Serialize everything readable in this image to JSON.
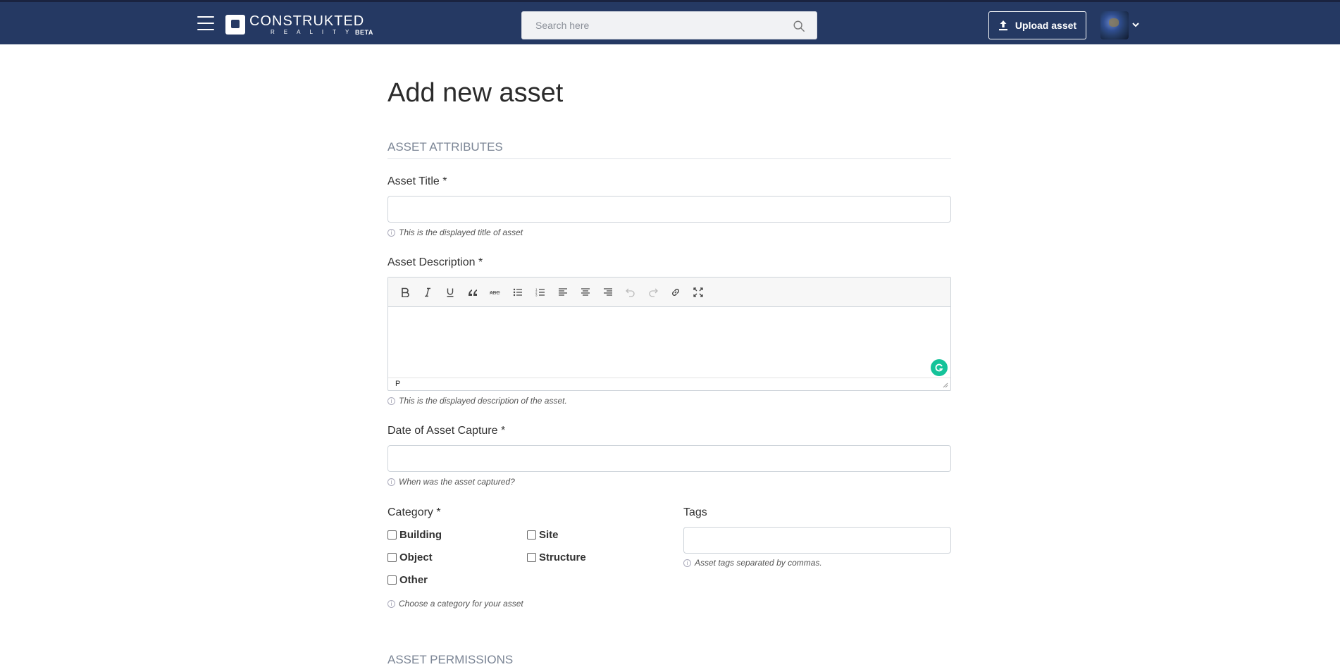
{
  "nav": {
    "logo_main": "CONSTRUKTED",
    "logo_sub": "REALITY",
    "logo_badge": "BETA",
    "search_placeholder": "Search here",
    "upload_label": "Upload asset",
    "brand_color": "#253963"
  },
  "page": {
    "title": "Add new asset",
    "section_attributes": "ASSET ATTRIBUTES",
    "section_permissions": "ASSET PERMISSIONS"
  },
  "form": {
    "title_label": "Asset Title *",
    "title_value": "",
    "title_help": "This is the displayed title of asset",
    "description_label": "Asset Description *",
    "description_help": "This is the displayed description of the asset.",
    "editor_status": "P",
    "editor_toolbar": [
      "bold-icon",
      "italic-icon",
      "underline-icon",
      "quote-icon",
      "strikethrough-icon",
      "bullet-list-icon",
      "numbered-list-icon",
      "align-left-icon",
      "align-center-icon",
      "align-right-icon",
      "undo-icon",
      "redo-icon",
      "link-icon",
      "fullscreen-icon"
    ],
    "date_label": "Date of Asset Capture *",
    "date_value": "",
    "date_help": "When was the asset captured?",
    "category_label": "Category *",
    "categories": [
      "Building",
      "Site",
      "Object",
      "Structure",
      "Other"
    ],
    "category_help": "Choose a category for your asset",
    "tags_label": "Tags",
    "tags_value": "",
    "tags_help": "Asset tags separated by commas."
  }
}
